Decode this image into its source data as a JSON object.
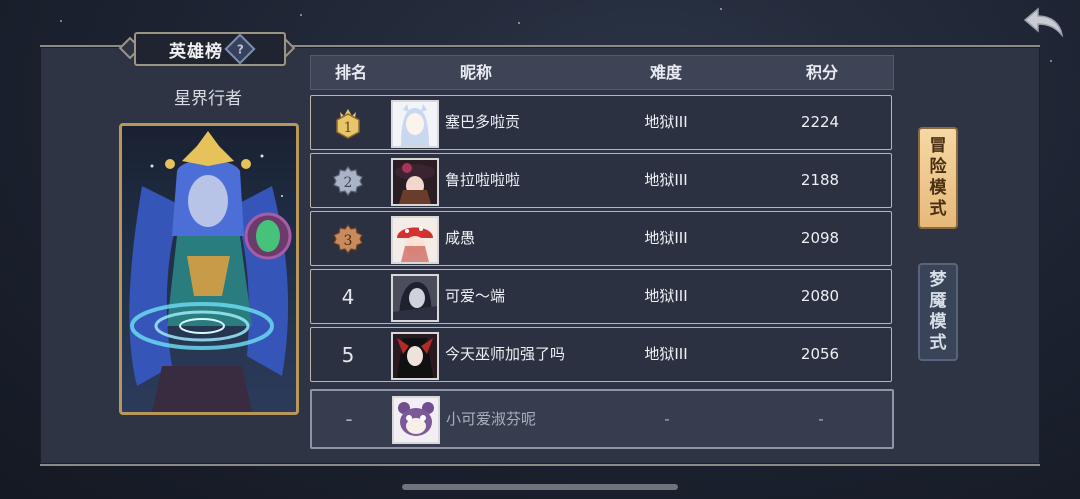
{
  "leaderboard": {
    "title": "英雄榜",
    "help_glyph": "?",
    "hero_name": "星界行者",
    "columns": {
      "rank": "排名",
      "nickname": "昵称",
      "difficulty": "难度",
      "score": "积分"
    },
    "rows": [
      {
        "rank": "1",
        "nickname": "塞巴多啦贡",
        "difficulty": "地狱III",
        "score": "2224",
        "medal": "gold"
      },
      {
        "rank": "2",
        "nickname": "鲁拉啦啦啦",
        "difficulty": "地狱III",
        "score": "2188",
        "medal": "silver"
      },
      {
        "rank": "3",
        "nickname": "咸愚",
        "difficulty": "地狱III",
        "score": "2098",
        "medal": "bronze"
      },
      {
        "rank": "4",
        "nickname": "可爱～端",
        "difficulty": "地狱III",
        "score": "2080"
      },
      {
        "rank": "5",
        "nickname": "今天巫师加强了吗",
        "difficulty": "地狱III",
        "score": "2056"
      }
    ],
    "self_row": {
      "rank": "-",
      "nickname": "小可爱淑芬呢",
      "difficulty": "-",
      "score": "-"
    }
  },
  "modes": {
    "adventure": [
      "冒",
      "险",
      "模",
      "式"
    ],
    "nightmare": [
      "梦",
      "魇",
      "模",
      "式"
    ]
  },
  "icons": {
    "back": "back-arrow-icon",
    "help": "help-icon"
  },
  "colors": {
    "gold": "#e8c46a",
    "silver": "#aab4c6",
    "bronze": "#c98b5e",
    "active_tab": "#f0cf95"
  }
}
